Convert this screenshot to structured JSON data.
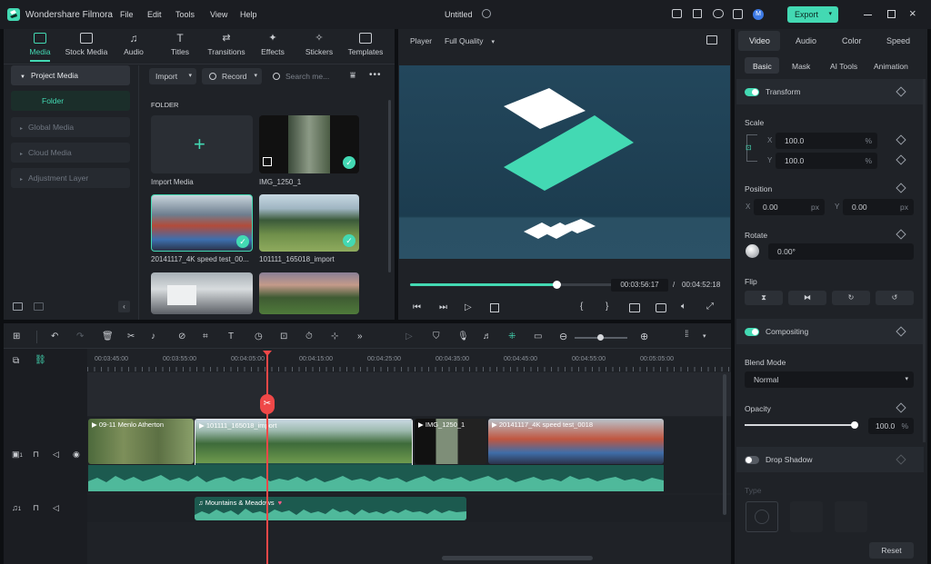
{
  "app": {
    "title": "Wondershare Filmora",
    "project_title": "Untitled",
    "export_label": "Export",
    "avatar_letter": "M"
  },
  "menu": [
    "File",
    "Edit",
    "Tools",
    "View",
    "Help"
  ],
  "media_tabs": [
    {
      "label": "Media",
      "icon": "media-icon"
    },
    {
      "label": "Stock Media",
      "icon": "stock-media-icon"
    },
    {
      "label": "Audio",
      "icon": "audio-icon"
    },
    {
      "label": "Titles",
      "icon": "titles-icon"
    },
    {
      "label": "Transitions",
      "icon": "transitions-icon"
    },
    {
      "label": "Effects",
      "icon": "effects-icon"
    },
    {
      "label": "Stickers",
      "icon": "stickers-icon"
    },
    {
      "label": "Templates",
      "icon": "templates-icon"
    }
  ],
  "sidebar": {
    "project_media": "Project Media",
    "folder": "Folder",
    "items": [
      "Global Media",
      "Cloud Media",
      "Adjustment Layer"
    ]
  },
  "media_toolbar": {
    "import": "Import",
    "record": "Record",
    "search_placeholder": "Search me..."
  },
  "media_grid": {
    "folder_label": "FOLDER",
    "items": [
      "Import Media",
      "IMG_1250_1",
      "20141117_4K speed test_00...",
      "101111_165018_import",
      "",
      ""
    ]
  },
  "player": {
    "label": "Player",
    "quality": "Full Quality",
    "current_time": "00:03:56:17",
    "separator": "/",
    "total_time": "00:04:52:18",
    "progress": 0.72
  },
  "right_panel": {
    "tabs": [
      "Video",
      "Audio",
      "Color",
      "Speed"
    ],
    "subtabs": [
      "Basic",
      "Mask",
      "AI Tools",
      "Animation"
    ],
    "transform": "Transform",
    "scale": {
      "label": "Scale",
      "x_label": "X",
      "x": "100.0",
      "y_label": "Y",
      "y": "100.0",
      "unit": "%"
    },
    "position": {
      "label": "Position",
      "x_label": "X",
      "x": "0.00",
      "y_label": "Y",
      "y": "0.00",
      "unit": "px"
    },
    "rotate": {
      "label": "Rotate",
      "value": "0.00°"
    },
    "flip": "Flip",
    "compositing": "Compositing",
    "blend_mode": {
      "label": "Blend Mode",
      "value": "Normal"
    },
    "opacity": {
      "label": "Opacity",
      "value": "100.0",
      "unit": "%",
      "level": 1.0
    },
    "drop_shadow": "Drop Shadow",
    "type": "Type",
    "reset": "Reset"
  },
  "timeline": {
    "ruler": [
      "00:03:45:00",
      "00:03:55:00",
      "00:04:05:00",
      "00:04:15:00",
      "00:04:25:00",
      "00:04:35:00",
      "00:04:45:00",
      "00:04:55:00",
      "00:05:05:00"
    ],
    "video_clips": [
      "09-11 Menlo Atherton",
      "101111_165018_import",
      "IMG_1250_1",
      "20141117_4K speed test_0018"
    ],
    "audio_clip": "Mountains & Meadows",
    "track_video_num": "1",
    "track_audio_num": "1"
  },
  "colors": {
    "accent": "#43d9b3",
    "playhead": "#ef4848",
    "audio_wave": "#4fb99b"
  }
}
